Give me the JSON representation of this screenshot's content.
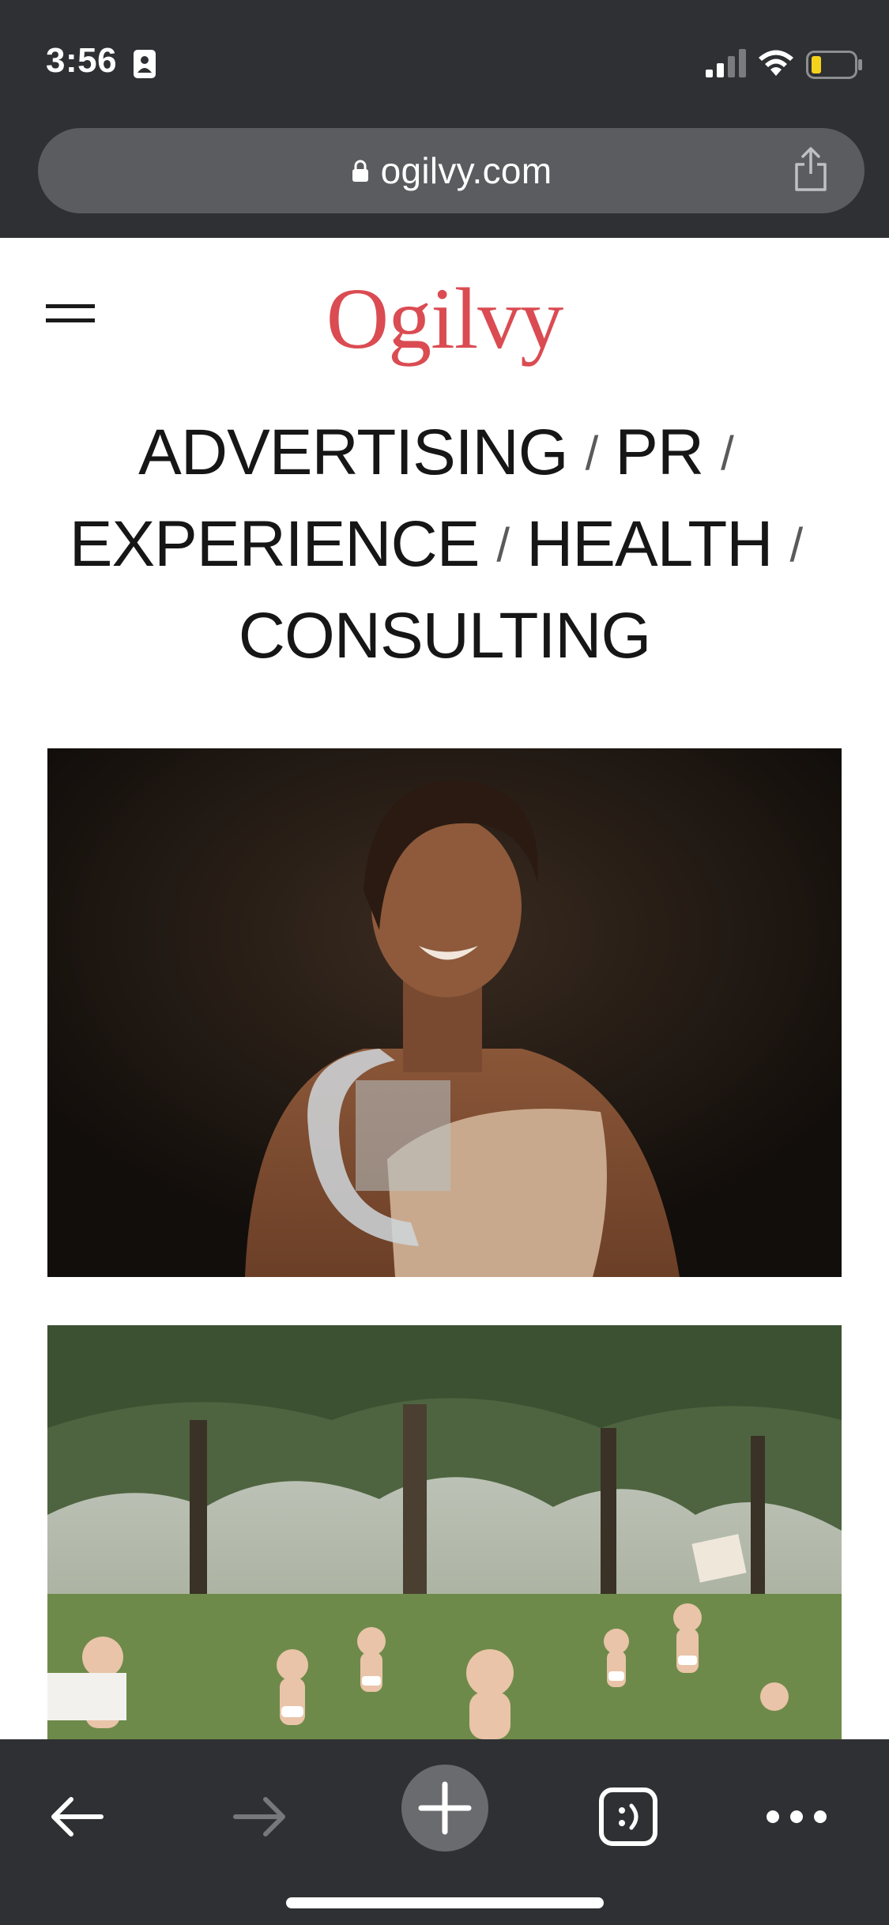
{
  "status_bar": {
    "time": "3:56"
  },
  "url_bar": {
    "domain": "ogilvy.com"
  },
  "header": {
    "logo_text": "Ogilvy"
  },
  "services": [
    "ADVERTISING",
    "PR",
    "EXPERIENCE",
    "HEALTH",
    "CONSULTING"
  ],
  "separator": "/",
  "colors": {
    "chrome_bg": "#2f3033",
    "url_pill": "#5b5c60",
    "brand_red": "#da4c52",
    "text": "#161616"
  },
  "icons": {
    "menu": "hamburger-icon",
    "share": "share-icon",
    "back": "back-arrow-icon",
    "forward": "forward-arrow-icon",
    "new_tab": "plus-icon",
    "tabs": "tab-switcher-icon",
    "more": "more-dots-icon",
    "lock": "lock-icon"
  }
}
